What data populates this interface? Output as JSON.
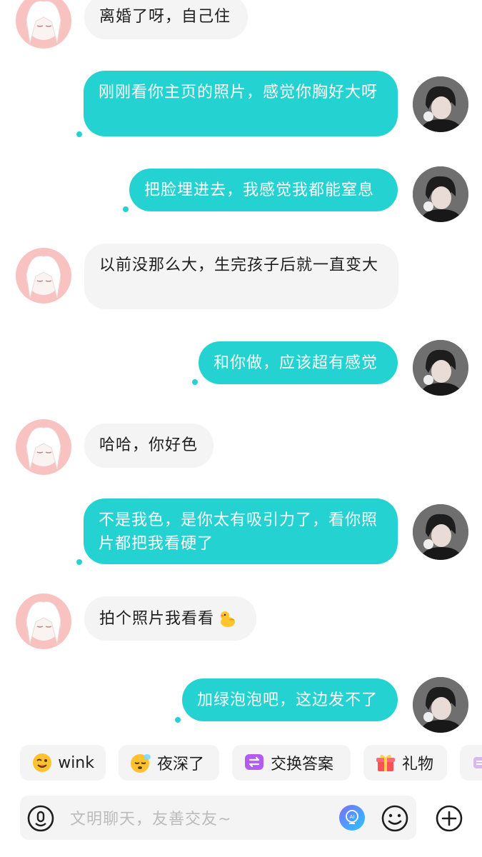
{
  "messages": [
    {
      "side": "in",
      "text": "离婚了呀，自己住"
    },
    {
      "side": "out",
      "text": "刚刚看你主页的照片，感觉你胸好大呀"
    },
    {
      "side": "out",
      "text": "把脸埋进去，我感觉我都能窒息"
    },
    {
      "side": "in",
      "text": "以前没那么大，生完孩子后就一直变大"
    },
    {
      "side": "out",
      "text": "和你做，应该超有感觉"
    },
    {
      "side": "in",
      "text": "哈哈，你好色"
    },
    {
      "side": "out",
      "text": "不是我色，是你太有吸引力了，看你照片都把我看硬了"
    },
    {
      "side": "in",
      "text": "拍个照片我看看"
    },
    {
      "side": "out",
      "text": "加绿泡泡吧，这边发不了"
    }
  ],
  "quick_actions": [
    {
      "label": "wink",
      "icon": "wink-emoji-icon"
    },
    {
      "label": "夜深了",
      "icon": "sleepy-emoji-icon"
    },
    {
      "label": "交换答案",
      "icon": "exchange-icon"
    },
    {
      "label": "礼物",
      "icon": "gift-icon"
    }
  ],
  "input": {
    "placeholder": "文明聊天，友善交友~"
  },
  "colors": {
    "outgoing_bubble": "#24d3d1",
    "incoming_bubble": "#f4f4f4",
    "read_dot": "#24d3d1"
  }
}
